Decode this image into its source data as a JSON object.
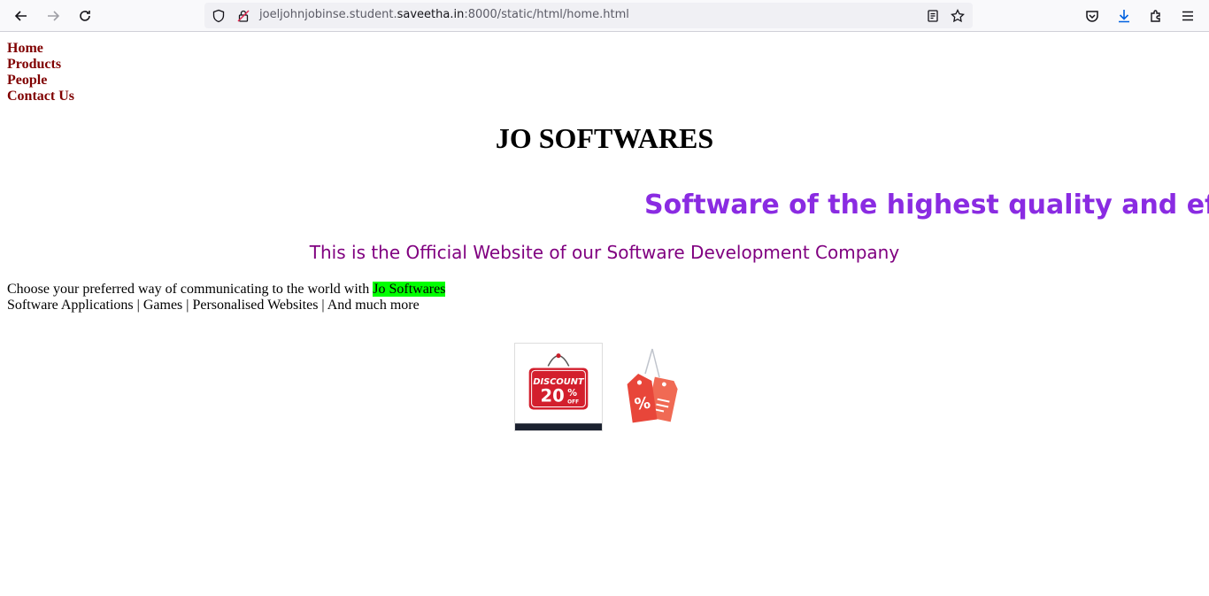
{
  "browser": {
    "url_prefix": "joeljohnjobinse.student.",
    "url_host": "saveetha.in",
    "url_suffix": ":8000/static/html/home.html"
  },
  "nav": {
    "items": [
      "Home",
      "Products",
      "People",
      "Contact Us"
    ]
  },
  "brand": "JO SOFTWARES",
  "marquee": "Software of the highest quality and effici",
  "tagline": "This is the Official Website of our Software Development Company",
  "intro": {
    "line1_prefix": "Choose your preferred way of communicating to the world with ",
    "highlight": "Jo Softwares",
    "line2": "Software Applications | Games | Personalised Websites | And much more"
  },
  "discount_image": {
    "label": "DISCOUNT",
    "value": "20",
    "unit": "%",
    "suffix": "OFF"
  },
  "colors": {
    "nav_link": "#800000",
    "marquee": "#8a2be2",
    "tagline": "#800080",
    "highlight": "#00ff00"
  }
}
